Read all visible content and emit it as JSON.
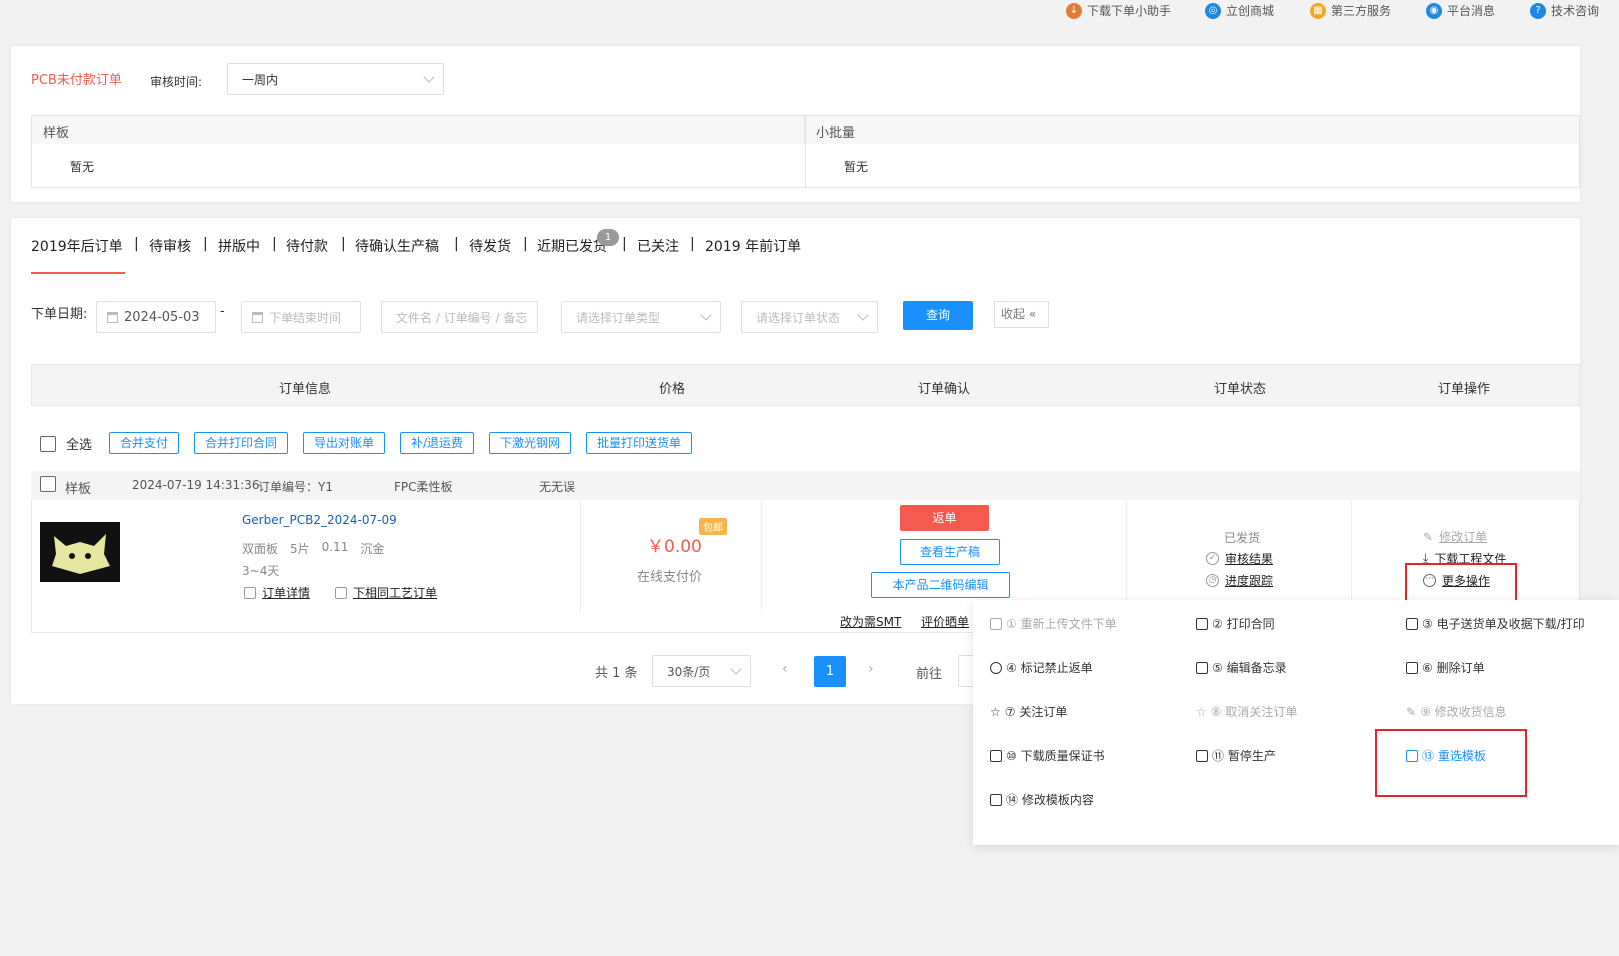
{
  "topbar": {
    "items": [
      {
        "label": "下载下单小助手",
        "icon": "download-helper-icon",
        "color": "#e07b39"
      },
      {
        "label": "立创商城",
        "icon": "mall-icon",
        "color": "#1e88e5"
      },
      {
        "label": "第三方服务",
        "icon": "third-party-icon",
        "color": "#f5a623"
      },
      {
        "label": "平台消息",
        "icon": "message-icon",
        "color": "#1e88e5"
      },
      {
        "label": "技术咨询",
        "icon": "tech-support-icon",
        "color": "#1e88e5"
      }
    ]
  },
  "unpaid": {
    "title": "PCB未付款订单",
    "audit_label": "审核时间:",
    "audit_value": "一周内",
    "sample": {
      "header": "样板",
      "value": "暂无"
    },
    "small_batch": {
      "header": "小批量",
      "value": "暂无"
    }
  },
  "tabs": [
    {
      "label": "2019年后订单",
      "active": true
    },
    {
      "label": "待审核"
    },
    {
      "label": "拼版中"
    },
    {
      "label": "待付款"
    },
    {
      "label": "待确认生产稿"
    },
    {
      "label": "待发货"
    },
    {
      "label": "近期已发货",
      "badge": "1"
    },
    {
      "label": "已关注"
    },
    {
      "label": "2019 年前订单"
    }
  ],
  "tab_separator": "|",
  "filters": {
    "date_label": "下单日期:",
    "start_date": "2024-05-03",
    "dash": "-",
    "end_placeholder": "下单结束时间",
    "keyword_placeholder": "文件名 / 订单编号 / 备忘",
    "type_placeholder": "请选择订单类型",
    "status_placeholder": "请选择订单状态",
    "query": "查询",
    "collapse": "收起"
  },
  "table": {
    "headers": [
      "订单信息",
      "价格",
      "订单确认",
      "订单状态",
      "订单操作"
    ]
  },
  "bulk": {
    "select_all": "全选",
    "buttons": [
      "合并支付",
      "合并打印合同",
      "导出对账单",
      "补/退运费",
      "下激光钢网",
      "批量打印送货单"
    ]
  },
  "order": {
    "type": "样板",
    "time": "2024-07-19 14:31:36",
    "number": "订单编号：Y1",
    "material": "FPC柔性板",
    "note": "无无误",
    "filename": "Gerber_PCB2_2024-07-09",
    "spec": [
      "双面板",
      "5片",
      "0.11",
      "沉金"
    ],
    "lead_time": "3~4天",
    "detail_link": "订单详情",
    "reorder_link": "下相同工艺订单",
    "price": "￥0.00",
    "shipping_badge": "包邮",
    "price_note": "在线支付价",
    "confirm": {
      "return_btn": "返单",
      "view_draft": "查看生产稿",
      "qr_edit": "本产品二维码编辑",
      "to_smt": "改为需SMT",
      "review": "评价晒单"
    },
    "status": {
      "text": "已发货",
      "audit_result": "审核结果",
      "progress": "进度跟踪"
    },
    "ops": {
      "modify": "修改订单",
      "download": "下载工程文件",
      "more": "更多操作"
    }
  },
  "pagination": {
    "total": "共 1 条",
    "page_size": "30条/页",
    "current": "1",
    "goto": "前往"
  },
  "more_menu": [
    {
      "label": "① 重新上传文件下单",
      "icon": "upload-doc-icon",
      "state": "disabled"
    },
    {
      "label": "② 打印合同",
      "icon": "printer-icon",
      "state": "normal"
    },
    {
      "label": "③ 电子送货单及收据下载/打印",
      "icon": "printer-icon",
      "state": "normal"
    },
    {
      "label": "④ 标记禁止返单",
      "icon": "ban-icon",
      "state": "normal"
    },
    {
      "label": "⑤ 编辑备忘录",
      "icon": "edit-icon",
      "state": "normal"
    },
    {
      "label": "⑥ 删除订单",
      "icon": "trash-icon",
      "state": "normal"
    },
    {
      "label": "⑦ 关注订单",
      "icon": "star-icon",
      "state": "normal"
    },
    {
      "label": "⑧ 取消关注订单",
      "icon": "star-off-icon",
      "state": "disabled"
    },
    {
      "label": "⑨ 修改收货信息",
      "icon": "pencil-icon",
      "state": "disabled"
    },
    {
      "label": "⑩ 下载质量保证书",
      "icon": "download-icon",
      "state": "normal"
    },
    {
      "label": "⑪ 暂停生产",
      "icon": "edit-icon",
      "state": "normal"
    },
    {
      "label": "⑬ 重选模板",
      "icon": "edit-icon",
      "state": "active"
    },
    {
      "label": "⑭ 修改模板内容",
      "icon": "edit-icon",
      "state": "normal"
    }
  ],
  "colors": {
    "accent": "#f45b4e",
    "primary": "#1890ff",
    "highlight_box": "#e8242a"
  }
}
